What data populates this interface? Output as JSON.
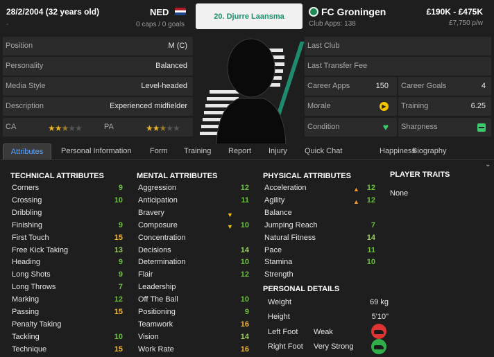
{
  "header": {
    "dob": "28/2/2004 (32 years old)",
    "dash": "-",
    "nationality": "NED",
    "caps": "0 caps / 0 goals",
    "player_name": "20. Djurre Laansma",
    "club_name": "FC Groningen",
    "club_apps": "Club Apps: 138",
    "value_range": "£190K - £475K",
    "wage": "£7,750 p/w",
    "flag_colors": [
      "#ae1c28",
      "#ffffff",
      "#21468b"
    ]
  },
  "left_info": [
    {
      "label": "Position",
      "value": "M (C)"
    },
    {
      "label": "Personality",
      "value": "Balanced"
    },
    {
      "label": "Media Style",
      "value": "Level-headed"
    },
    {
      "label": "Description",
      "value": "Experienced midfielder"
    }
  ],
  "ability": {
    "ca_label": "CA",
    "pa_label": "PA",
    "ca_stars": 2.5,
    "pa_stars": 2.5,
    "max_stars": 5
  },
  "right_info": {
    "last_club": "Last Club",
    "last_transfer_fee": "Last Transfer Fee",
    "career_apps_label": "Career Apps",
    "career_apps": "150",
    "career_goals_label": "Career Goals",
    "career_goals": "4",
    "morale_label": "Morale",
    "training_label": "Training",
    "training": "6.25",
    "condition_label": "Condition",
    "sharpness_label": "Sharpness"
  },
  "tabs": [
    "Attributes",
    "Personal Information",
    "Form",
    "Training",
    "Report",
    "Injury",
    "Quick Chat",
    "Happiness",
    "Biography"
  ],
  "technical": {
    "title": "TECHNICAL ATTRIBUTES",
    "items": [
      {
        "name": "Corners",
        "value": "9"
      },
      {
        "name": "Crossing",
        "value": "10"
      },
      {
        "name": "Dribbling",
        "value": ""
      },
      {
        "name": "Finishing",
        "value": "9"
      },
      {
        "name": "First Touch",
        "value": "15"
      },
      {
        "name": "Free Kick Taking",
        "value": "13"
      },
      {
        "name": "Heading",
        "value": "9"
      },
      {
        "name": "Long Shots",
        "value": "9"
      },
      {
        "name": "Long Throws",
        "value": "7"
      },
      {
        "name": "Marking",
        "value": "12"
      },
      {
        "name": "Passing",
        "value": "15"
      },
      {
        "name": "Penalty Taking",
        "value": ""
      },
      {
        "name": "Tackling",
        "value": "10"
      },
      {
        "name": "Technique",
        "value": "15"
      }
    ]
  },
  "mental": {
    "title": "MENTAL ATTRIBUTES",
    "items": [
      {
        "name": "Aggression",
        "value": "12"
      },
      {
        "name": "Anticipation",
        "value": "11"
      },
      {
        "name": "Bravery",
        "value": ""
      },
      {
        "name": "Composure",
        "value": "10"
      },
      {
        "name": "Concentration",
        "value": ""
      },
      {
        "name": "Decisions",
        "value": "14"
      },
      {
        "name": "Determination",
        "value": "10"
      },
      {
        "name": "Flair",
        "value": "12"
      },
      {
        "name": "Leadership",
        "value": ""
      },
      {
        "name": "Off The Ball",
        "value": "10"
      },
      {
        "name": "Positioning",
        "value": "9"
      },
      {
        "name": "Teamwork",
        "value": "16"
      },
      {
        "name": "Vision",
        "value": "14"
      },
      {
        "name": "Work Rate",
        "value": "16"
      }
    ]
  },
  "physical": {
    "title": "PHYSICAL ATTRIBUTES",
    "items": [
      {
        "name": "Acceleration",
        "value": "12"
      },
      {
        "name": "Agility",
        "value": "12"
      },
      {
        "name": "Balance",
        "value": ""
      },
      {
        "name": "Jumping Reach",
        "value": "7"
      },
      {
        "name": "Natural Fitness",
        "value": "14"
      },
      {
        "name": "Pace",
        "value": "11"
      },
      {
        "name": "Stamina",
        "value": "10"
      },
      {
        "name": "Strength",
        "value": ""
      }
    ]
  },
  "personal": {
    "title": "PERSONAL DETAILS",
    "weight_label": "Weight",
    "weight": "69 kg",
    "height_label": "Height",
    "height": "5'10\"",
    "left_foot_label": "Left Foot",
    "left_foot": "Weak",
    "right_foot_label": "Right Foot",
    "right_foot": "Very Strong"
  },
  "traits": {
    "title": "PLAYER TRAITS",
    "value": "None"
  }
}
